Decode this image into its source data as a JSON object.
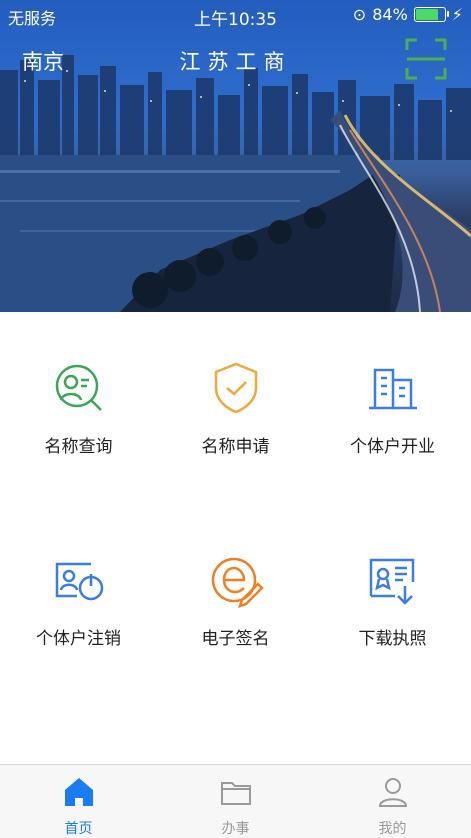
{
  "status_bar": {
    "carrier": "无服务",
    "time": "上午10:35",
    "battery": "84%",
    "battery_level": 0.84
  },
  "header": {
    "city": "南京",
    "title": "江苏工商"
  },
  "services": [
    {
      "label": "名称查询",
      "icon": "name-search-icon",
      "color": "#3aa65a"
    },
    {
      "label": "名称申请",
      "icon": "shield-check-icon",
      "color": "#f2a93b"
    },
    {
      "label": "个体户开业",
      "icon": "building-icon",
      "color": "#3b7de0"
    },
    {
      "label": "个体户注销",
      "icon": "id-card-power-icon",
      "color": "#3b7de0"
    },
    {
      "label": "电子签名",
      "icon": "e-signature-icon",
      "color": "#f07f22"
    },
    {
      "label": "下载执照",
      "icon": "license-download-icon",
      "color": "#3b7de0"
    }
  ],
  "tabs": [
    {
      "label": "首页",
      "icon": "home-icon",
      "active": true
    },
    {
      "label": "办事",
      "icon": "folder-icon",
      "active": false
    },
    {
      "label": "我的",
      "icon": "user-icon",
      "active": false
    }
  ],
  "colors": {
    "accent": "#1a7cf2",
    "scan_frame": "#4caf50"
  }
}
